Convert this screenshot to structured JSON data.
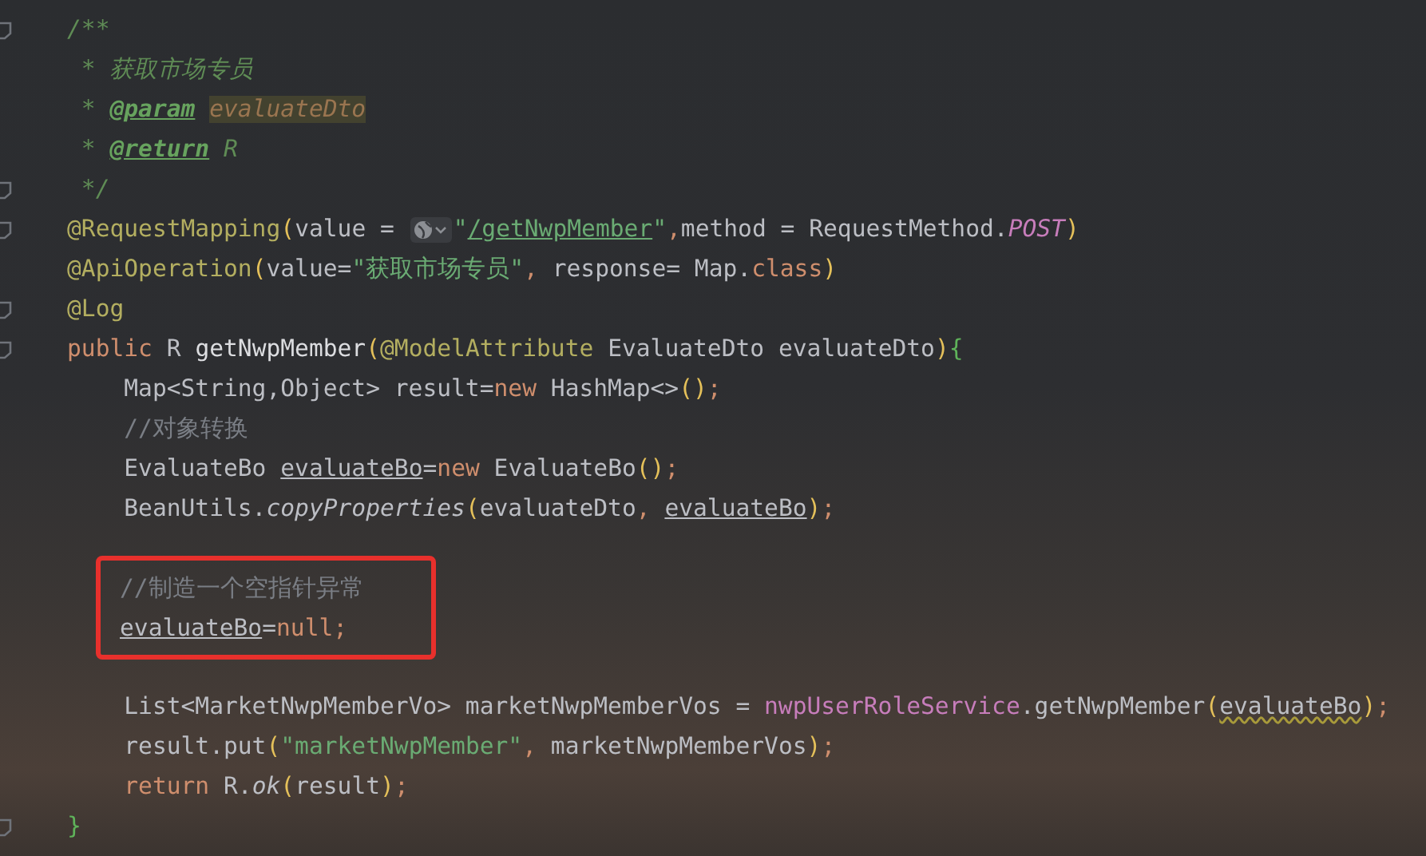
{
  "editor": {
    "lines": [
      {
        "kind": "line",
        "fold_marker": true,
        "tokens": [
          {
            "kind": "doc",
            "text": "/**"
          }
        ]
      },
      {
        "kind": "line",
        "fold_marker": false,
        "tokens": [
          {
            "kind": "doc",
            "text": " * 获取市场专员"
          }
        ]
      },
      {
        "kind": "line",
        "fold_marker": false,
        "tokens": [
          {
            "kind": "doc",
            "text": " * "
          },
          {
            "kind": "doc-tag",
            "text": "@param"
          },
          {
            "kind": "doc-param",
            "text": "evaluateDto"
          }
        ]
      },
      {
        "kind": "line",
        "fold_marker": false,
        "tokens": [
          {
            "kind": "doc",
            "text": " * "
          },
          {
            "kind": "doc-tag",
            "text": "@return"
          },
          {
            "kind": "doc",
            "text": "R"
          }
        ]
      },
      {
        "kind": "line",
        "fold_marker": true,
        "tokens": [
          {
            "kind": "doc",
            "text": " */"
          }
        ]
      },
      {
        "kind": "line",
        "fold_marker": true,
        "tokens": [
          {
            "kind": "annotation",
            "text": "@RequestMapping"
          },
          {
            "kind": "bracket",
            "text": "("
          },
          {
            "kind": "plain",
            "text": "value = "
          },
          {
            "kind": "url-icon"
          },
          {
            "kind": "string",
            "text": "\""
          },
          {
            "kind": "url",
            "text": "/getNwpMember"
          },
          {
            "kind": "string",
            "text": "\""
          },
          {
            "kind": "keyword",
            "text": ","
          },
          {
            "kind": "plain",
            "text": "method = RequestMethod."
          },
          {
            "kind": "field-italic",
            "text": "POST"
          },
          {
            "kind": "bracket",
            "text": ")"
          }
        ]
      },
      {
        "kind": "line",
        "fold_marker": false,
        "tokens": [
          {
            "kind": "annotation",
            "text": "@ApiOperation"
          },
          {
            "kind": "bracket",
            "text": "("
          },
          {
            "kind": "plain",
            "text": "value="
          },
          {
            "kind": "string",
            "text": "\"获取市场专员\""
          },
          {
            "kind": "keyword",
            "text": ","
          },
          {
            "kind": "plain",
            "text": " response= Map."
          },
          {
            "kind": "keyword",
            "text": "class"
          },
          {
            "kind": "bracket",
            "text": ")"
          }
        ]
      },
      {
        "kind": "line",
        "fold_marker": true,
        "tokens": [
          {
            "kind": "annotation",
            "text": "@Log"
          }
        ]
      },
      {
        "kind": "line",
        "fold_marker": true,
        "tokens": [
          {
            "kind": "keyword",
            "text": "public"
          },
          {
            "kind": "plain",
            "text": " R "
          },
          {
            "kind": "method",
            "text": "getNwpMember"
          },
          {
            "kind": "bracket",
            "text": "("
          },
          {
            "kind": "annotation",
            "text": "@ModelAttribute"
          },
          {
            "kind": "plain",
            "text": " EvaluateDto evaluateDto"
          },
          {
            "kind": "bracket",
            "text": ")"
          },
          {
            "kind": "brace",
            "text": "{"
          }
        ]
      },
      {
        "kind": "line",
        "fold_marker": false,
        "tokens": [
          {
            "kind": "plain",
            "text": "    Map<String,Object> result="
          },
          {
            "kind": "keyword",
            "text": "new"
          },
          {
            "kind": "plain",
            "text": " HashMap<>"
          },
          {
            "kind": "bracket",
            "text": "()"
          },
          {
            "kind": "keyword",
            "text": ";"
          }
        ]
      },
      {
        "kind": "line",
        "fold_marker": false,
        "tokens": [
          {
            "kind": "line-comment",
            "text": "    //对象转换"
          }
        ]
      },
      {
        "kind": "line",
        "fold_marker": false,
        "tokens": [
          {
            "kind": "plain",
            "text": "    EvaluateBo "
          },
          {
            "kind": "reassigned",
            "text": "evaluateBo"
          },
          {
            "kind": "plain",
            "text": "="
          },
          {
            "kind": "keyword",
            "text": "new"
          },
          {
            "kind": "plain",
            "text": " EvaluateBo"
          },
          {
            "kind": "bracket",
            "text": "()"
          },
          {
            "kind": "keyword",
            "text": ";"
          }
        ]
      },
      {
        "kind": "line",
        "fold_marker": false,
        "tokens": [
          {
            "kind": "plain",
            "text": "    BeanUtils."
          },
          {
            "kind": "static-call",
            "text": "copyProperties"
          },
          {
            "kind": "bracket",
            "text": "("
          },
          {
            "kind": "plain",
            "text": "evaluateDto"
          },
          {
            "kind": "keyword",
            "text": ", "
          },
          {
            "kind": "reassigned",
            "text": "evaluateBo"
          },
          {
            "kind": "bracket",
            "text": ")"
          },
          {
            "kind": "keyword",
            "text": ";"
          }
        ]
      },
      {
        "kind": "blank"
      },
      {
        "kind": "box",
        "lines": [
          {
            "kind": "line",
            "fold_marker": false,
            "tokens": [
              {
                "kind": "line-comment",
                "text": "//制造一个空指针异常"
              }
            ]
          },
          {
            "kind": "line",
            "fold_marker": false,
            "tokens": [
              {
                "kind": "reassigned",
                "text": "evaluateBo"
              },
              {
                "kind": "plain",
                "text": "="
              },
              {
                "kind": "keyword",
                "text": "null"
              },
              {
                "kind": "keyword",
                "text": ";"
              }
            ]
          }
        ]
      },
      {
        "kind": "blank"
      },
      {
        "kind": "line",
        "fold_marker": false,
        "tokens": [
          {
            "kind": "plain",
            "text": "    List<MarketNwpMemberVo> marketNwpMemberVos = "
          },
          {
            "kind": "field",
            "text": "nwpUserRoleService"
          },
          {
            "kind": "plain",
            "text": ".getNwpMember"
          },
          {
            "kind": "bracket",
            "text": "("
          },
          {
            "kind": "warning",
            "text": "evaluateBo"
          },
          {
            "kind": "bracket",
            "text": ")"
          },
          {
            "kind": "keyword",
            "text": ";"
          }
        ]
      },
      {
        "kind": "line",
        "fold_marker": false,
        "tokens": [
          {
            "kind": "plain",
            "text": "    result.put"
          },
          {
            "kind": "bracket",
            "text": "("
          },
          {
            "kind": "string",
            "text": "\"marketNwpMember\""
          },
          {
            "kind": "keyword",
            "text": ","
          },
          {
            "kind": "plain",
            "text": " marketNwpMemberVos"
          },
          {
            "kind": "bracket",
            "text": ")"
          },
          {
            "kind": "keyword",
            "text": ";"
          }
        ]
      },
      {
        "kind": "line",
        "fold_marker": false,
        "tokens": [
          {
            "kind": "keyword",
            "text": "    return"
          },
          {
            "kind": "plain",
            "text": " R."
          },
          {
            "kind": "static-call",
            "text": "ok"
          },
          {
            "kind": "bracket",
            "text": "("
          },
          {
            "kind": "plain",
            "text": "result"
          },
          {
            "kind": "bracket",
            "text": ")"
          },
          {
            "kind": "keyword",
            "text": ";"
          }
        ]
      },
      {
        "kind": "line",
        "fold_marker": true,
        "tokens": [
          {
            "kind": "brace",
            "text": "}"
          }
        ]
      }
    ]
  }
}
